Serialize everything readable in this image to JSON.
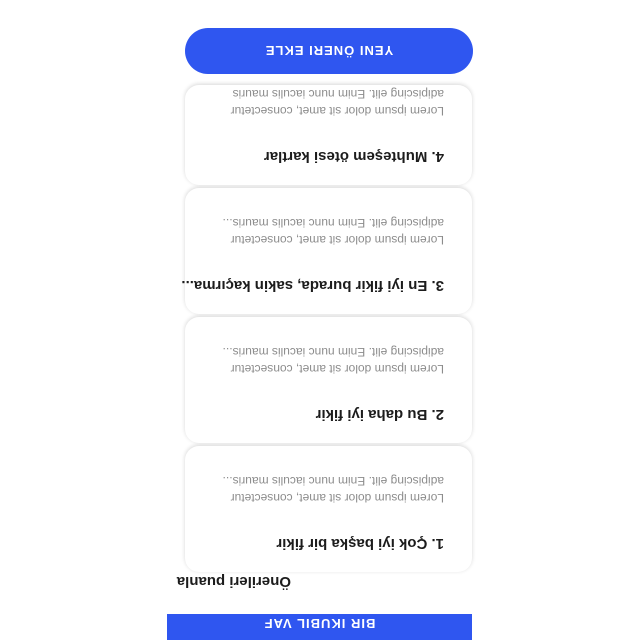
{
  "header": {
    "label": "BIR IKUBIL VAF"
  },
  "section": {
    "title": "Önerileri puanla"
  },
  "cards": [
    {
      "title": "1.  Çok iyi başka bir fikir",
      "line1": "Lorem ipsum dolor sit amet, consectetur",
      "line2": "adipiscing elit. Enim nunc iaculis mauris..."
    },
    {
      "title": "2. Bu daha iyi fikir",
      "line1": "Lorem ipsum dolor sit amet, consectetur",
      "line2": "adipiscing elit. Enim nunc iaculis mauris..."
    },
    {
      "title": "3. En iyi fikir burada, sakin kaçırma...",
      "line1": "Lorem ipsum dolor sit amet, consectetur",
      "line2": "adipiscing elit. Enim nunc iaculis mauris..."
    },
    {
      "title": "4. Muhteşem ötesi kartlar",
      "line1": "Lorem ipsum dolor sit amet, consectetur",
      "line2": "adipiscing elit. Enim nunc iaculis mauris"
    }
  ],
  "add_button": {
    "label": "YENI ÖNERI EKLE"
  },
  "colors": {
    "accent": "#2f56f0",
    "title": "#1c1c1c",
    "body": "#8c8c8c"
  }
}
